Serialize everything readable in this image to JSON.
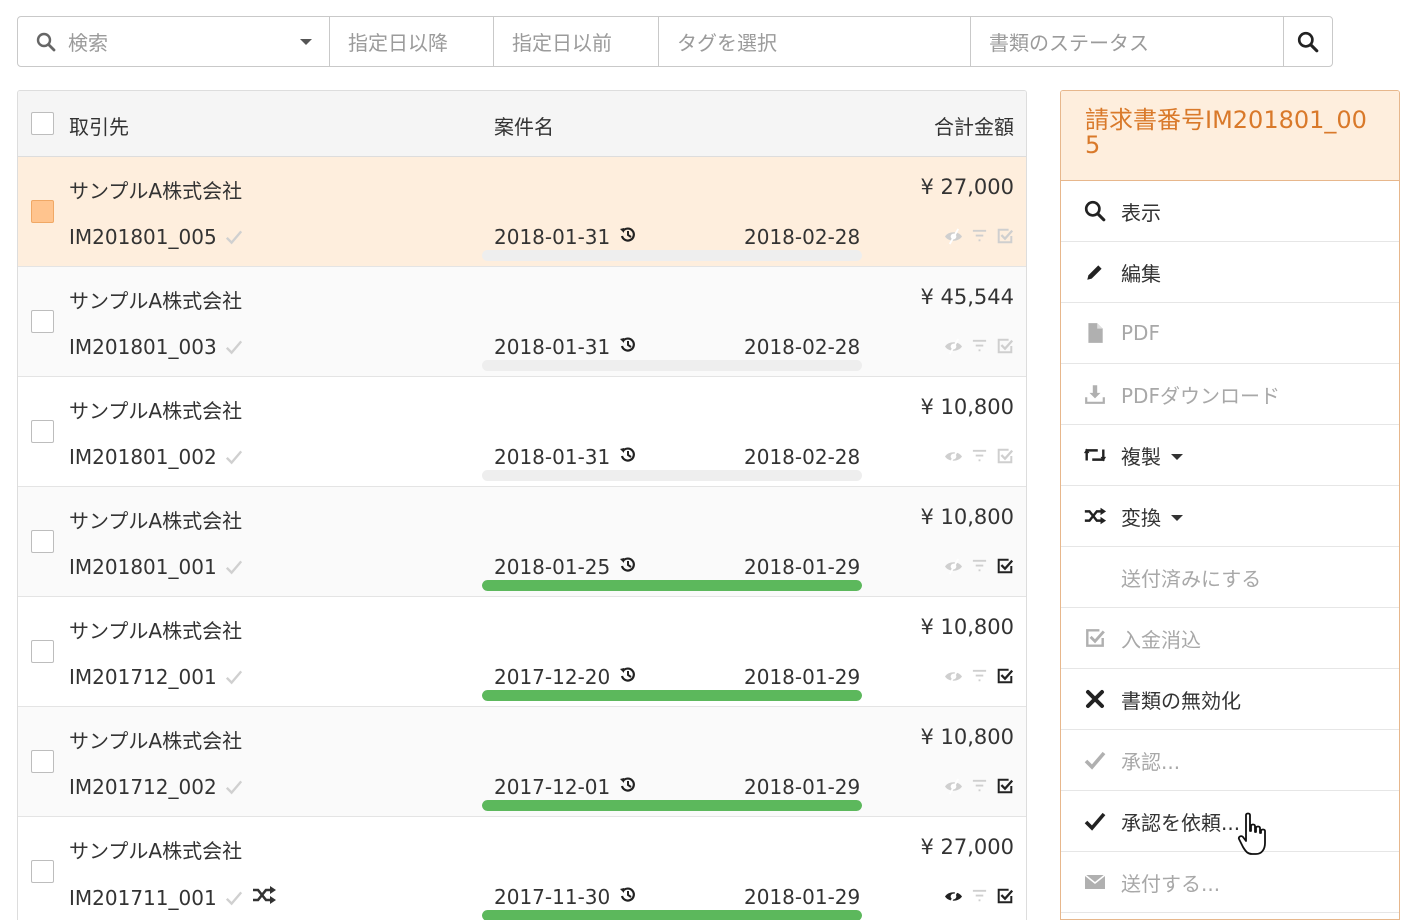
{
  "filters": {
    "search_placeholder": "検索",
    "date_after_placeholder": "指定日以降",
    "date_before_placeholder": "指定日以前",
    "tags_placeholder": "タグを選択",
    "status_placeholder": "書類のステータス"
  },
  "table": {
    "headers": {
      "client": "取引先",
      "subject": "案件名",
      "total": "合計金額"
    },
    "rows": [
      {
        "client": "サンプルA株式会社",
        "number": "IM201801_005",
        "date1": "2018-01-31",
        "date2": "2018-02-28",
        "amount": "¥ 27,000",
        "progress": 0,
        "sent": false,
        "paid": false,
        "selected": true
      },
      {
        "client": "サンプルA株式会社",
        "number": "IM201801_003",
        "date1": "2018-01-31",
        "date2": "2018-02-28",
        "amount": "¥ 45,544",
        "progress": 0,
        "sent": false,
        "paid": false,
        "selected": false
      },
      {
        "client": "サンプルA株式会社",
        "number": "IM201801_002",
        "date1": "2018-01-31",
        "date2": "2018-02-28",
        "amount": "¥ 10,800",
        "progress": 0,
        "sent": false,
        "paid": false,
        "selected": false
      },
      {
        "client": "サンプルA株式会社",
        "number": "IM201801_001",
        "date1": "2018-01-25",
        "date2": "2018-01-29",
        "amount": "¥ 10,800",
        "progress": 1,
        "sent": true,
        "paid": true,
        "selected": false
      },
      {
        "client": "サンプルA株式会社",
        "number": "IM201712_001",
        "date1": "2017-12-20",
        "date2": "2018-01-29",
        "amount": "¥ 10,800",
        "progress": 1,
        "sent": false,
        "paid": true,
        "selected": false
      },
      {
        "client": "サンプルA株式会社",
        "number": "IM201712_002",
        "date1": "2017-12-01",
        "date2": "2018-01-29",
        "amount": "¥ 10,800",
        "progress": 1,
        "sent": false,
        "paid": true,
        "selected": false
      },
      {
        "client": "サンプルA株式会社",
        "number": "IM201711_001",
        "date1": "2017-11-30",
        "date2": "2018-01-29",
        "amount": "¥ 27,000",
        "progress": 1,
        "sent": true,
        "paid": true,
        "selected": false
      }
    ]
  },
  "menu": {
    "title": "請求書番号IM201801_005",
    "items": [
      {
        "label": "表示",
        "icon": "search-icon",
        "disabled": false
      },
      {
        "label": "編集",
        "icon": "pencil-icon",
        "disabled": false
      },
      {
        "label": "PDF",
        "icon": "file-icon",
        "disabled": true
      },
      {
        "label": "PDFダウンロード",
        "icon": "download-icon",
        "disabled": true
      },
      {
        "label": "複製",
        "icon": "retweet-icon",
        "disabled": false,
        "dropdown": true
      },
      {
        "label": "変換",
        "icon": "shuffle-icon",
        "disabled": false,
        "dropdown": true
      },
      {
        "label": "送付済みにする",
        "icon": "share-arrow-icon",
        "disabled": true
      },
      {
        "label": "入金消込",
        "icon": "check-square-icon",
        "disabled": true
      },
      {
        "label": "書類の無効化",
        "icon": "times-icon",
        "disabled": false
      },
      {
        "label": "承認...",
        "icon": "check-icon",
        "disabled": true
      },
      {
        "label": "承認を依頼...",
        "icon": "check-icon",
        "disabled": false
      },
      {
        "label": "送付する...",
        "icon": "envelope-icon",
        "disabled": true
      }
    ]
  },
  "colors": {
    "accent": "#d9792a",
    "selected_row": "#feeedd",
    "progress": "#5cb85c"
  }
}
